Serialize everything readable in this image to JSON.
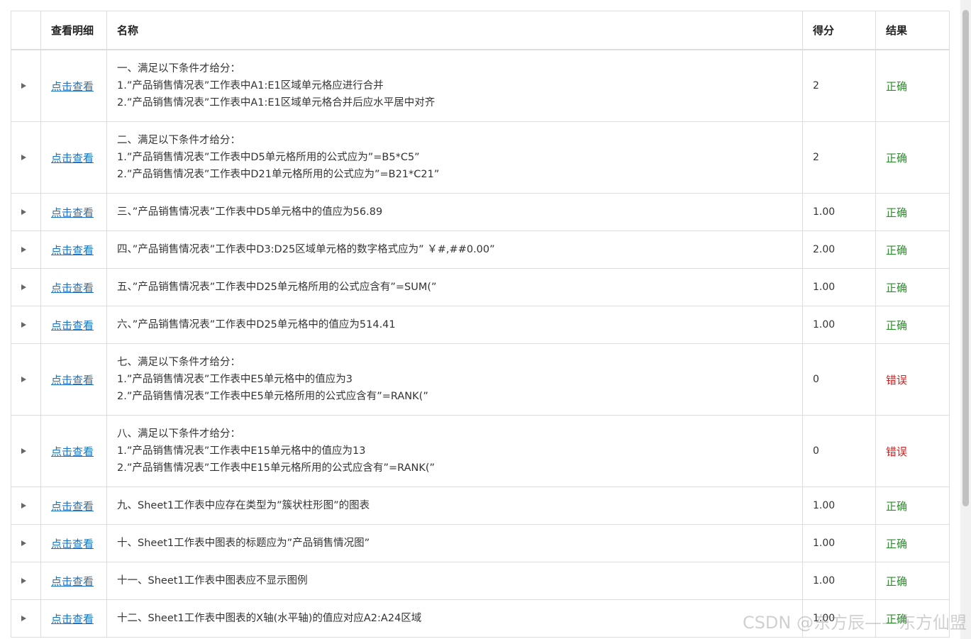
{
  "colors": {
    "link": "#1a73c8",
    "ok": "#2e8b2e",
    "error": "#cc2222"
  },
  "header": {
    "view": "查看明细",
    "name": "名称",
    "score": "得分",
    "result": "结果"
  },
  "rows": [
    {
      "view": "点击查看",
      "lines": [
        "一、满足以下条件才给分：",
        "1.”产品销售情况表”工作表中A1:E1区域单元格应进行合并",
        "2.”产品销售情况表”工作表中A1:E1区域单元格合并后应水平居中对齐"
      ],
      "score": "2",
      "result": "正确",
      "status": "ok"
    },
    {
      "view": "点击查看",
      "lines": [
        "二、满足以下条件才给分：",
        "1.”产品销售情况表”工作表中D5单元格所用的公式应为”=B5*C5”",
        "2.”产品销售情况表”工作表中D21单元格所用的公式应为”=B21*C21”"
      ],
      "score": "2",
      "result": "正确",
      "status": "ok"
    },
    {
      "view": "点击查看",
      "lines": [
        "三、”产品销售情况表”工作表中D5单元格中的值应为56.89"
      ],
      "score": "1.00",
      "result": "正确",
      "status": "ok"
    },
    {
      "view": "点击查看",
      "lines": [
        "四、”产品销售情况表”工作表中D3:D25区域单元格的数字格式应为” ￥#,##0.00”"
      ],
      "score": "2.00",
      "result": "正确",
      "status": "ok"
    },
    {
      "view": "点击查看",
      "lines": [
        "五、”产品销售情况表”工作表中D25单元格所用的公式应含有”=SUM(”"
      ],
      "score": "1.00",
      "result": "正确",
      "status": "ok"
    },
    {
      "view": "点击查看",
      "lines": [
        "六、”产品销售情况表”工作表中D25单元格中的值应为514.41"
      ],
      "score": "1.00",
      "result": "正确",
      "status": "ok"
    },
    {
      "view": "点击查看",
      "lines": [
        "七、满足以下条件才给分：",
        "1.”产品销售情况表”工作表中E5单元格中的值应为3",
        "2.”产品销售情况表”工作表中E5单元格所用的公式应含有”=RANK(”"
      ],
      "score": "0",
      "result": "错误",
      "status": "error"
    },
    {
      "view": "点击查看",
      "lines": [
        "八、满足以下条件才给分：",
        "1.”产品销售情况表”工作表中E15单元格中的值应为13",
        "2.”产品销售情况表”工作表中E15单元格所用的公式应含有”=RANK(”"
      ],
      "score": "0",
      "result": "错误",
      "status": "error"
    },
    {
      "view": "点击查看",
      "lines": [
        "九、Sheet1工作表中应存在类型为”簇状柱形图”的图表"
      ],
      "score": "1.00",
      "result": "正确",
      "status": "ok"
    },
    {
      "view": "点击查看",
      "lines": [
        "十、Sheet1工作表中图表的标题应为”产品销售情况图”"
      ],
      "score": "1.00",
      "result": "正确",
      "status": "ok"
    },
    {
      "view": "点击查看",
      "lines": [
        "十一、Sheet1工作表中图表应不显示图例"
      ],
      "score": "1.00",
      "result": "正确",
      "status": "ok"
    },
    {
      "view": "点击查看",
      "lines": [
        "十二、Sheet1工作表中图表的X轴(水平轴)的值应对应A2:A24区域"
      ],
      "score": "1.00",
      "result": "正确",
      "status": "ok"
    }
  ],
  "watermark": "CSDN @东方辰——东方仙盟",
  "icons": {
    "expand": "triangle-right-icon"
  }
}
